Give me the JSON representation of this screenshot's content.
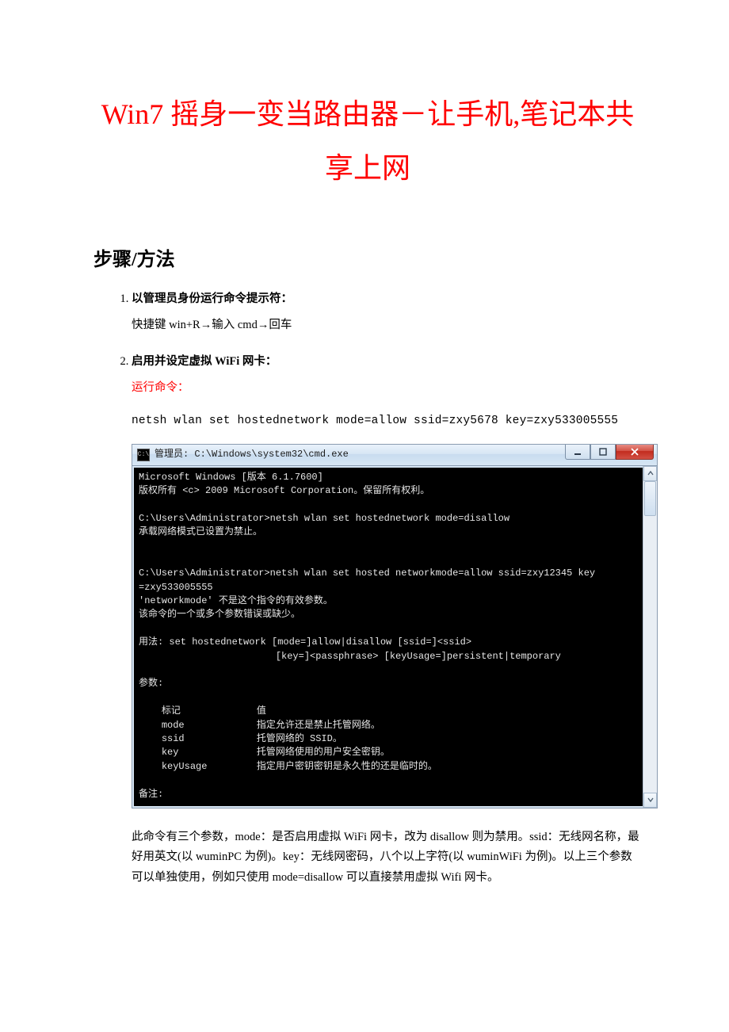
{
  "title": "Win7 摇身一变当路由器－让手机,笔记本共享上网",
  "section_heading": "步骤/方法",
  "steps": [
    {
      "title": "以管理员身份运行命令提示符：",
      "body": "快捷键 win+R→输入 cmd→回车"
    },
    {
      "title": "启用并设定虚拟 WiFi 网卡：",
      "run_label": "运行命令：",
      "command": "netsh wlan set hostednetwork mode=allow ssid=zxy5678 key=zxy533005555",
      "note": "此命令有三个参数，mode：是否启用虚拟 WiFi 网卡，改为 disallow 则为禁用。ssid：无线网名称，最好用英文(以 wuminPC 为例)。key：无线网密码，八个以上字符(以 wuminWiFi 为例)。以上三个参数可以单独使用，例如只使用 mode=disallow 可以直接禁用虚拟 Wifi 网卡。"
    }
  ],
  "cmd_window": {
    "title": "管理员: C:\\Windows\\system32\\cmd.exe",
    "lines": {
      "l1": "Microsoft Windows [版本 6.1.7600]",
      "l2": "版权所有 <c> 2009 Microsoft Corporation。保留所有权利。",
      "l3": "C:\\Users\\Administrator>netsh wlan set hostednetwork mode=disallow",
      "l4": "承载网络模式已设置为禁止。",
      "l5": "C:\\Users\\Administrator>netsh wlan set hosted networkmode=allow ssid=zxy12345 key",
      "l6": "=zxy533005555",
      "l7": "'networkmode' 不是这个指令的有效参数。",
      "l8": "该命令的一个或多个参数错误或缺少。",
      "l9": "用法: set hostednetwork [mode=]allow|disallow [ssid=]<ssid>",
      "l10": "                        [key=]<passphrase> [keyUsage=]persistent|temporary",
      "l11": "参数:",
      "l12a": "标记",
      "l12b": "值",
      "l13a": "mode",
      "l13b": "指定允许还是禁止托管网络。",
      "l14a": "ssid",
      "l14b": "托管网络的 SSID。",
      "l15a": "key",
      "l15b": "托管网络使用的用户安全密钥。",
      "l16a": "keyUsage",
      "l16b": "指定用户密钥密钥是永久性的还是临时的。",
      "l17": "备注:"
    }
  }
}
